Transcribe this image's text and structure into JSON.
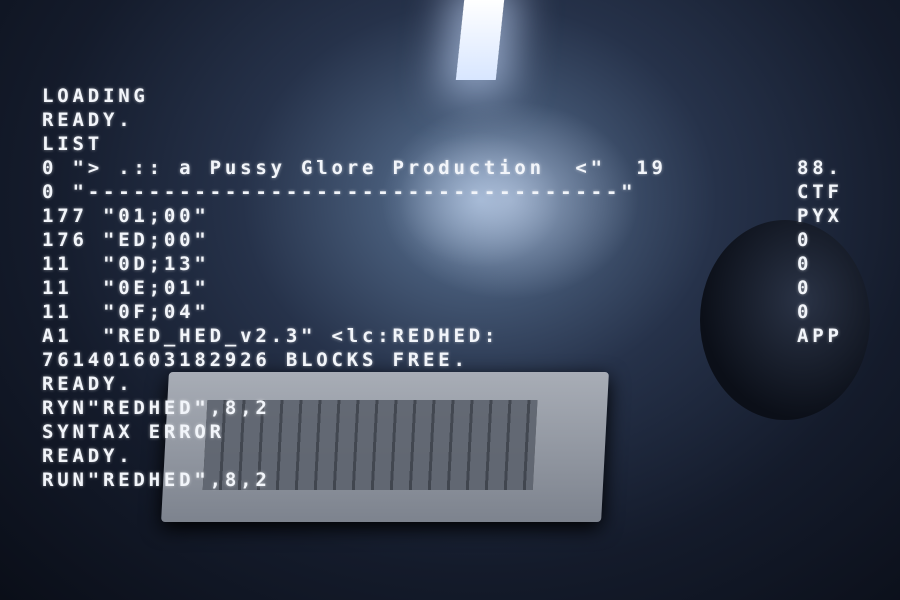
{
  "terminal_lines": [
    "LOADING",
    "READY.",
    "LIST",
    "0 \"> .:: a Pussy Glore Production  <\"  19",
    "0 \"-----------------------------------\"",
    "177 \"01;00\"",
    "176 \"ED;00\"",
    "11  \"0D;13\"",
    "11  \"0E;01\"",
    "11  \"0F;04\"",
    "A1  \"RED_HED_v2.3\" <lc:REDHED:",
    "761401603182926 BLOCKS FREE.",
    "READY.",
    "RYN\"REDHED\",8,2",
    "SYNTAX ERROR",
    "READY.",
    "RUN\"REDHED\",8,2"
  ],
  "right_column": [
    "88.",
    "CTF",
    "PYX",
    "0",
    "0",
    "0",
    "0",
    "APP"
  ]
}
